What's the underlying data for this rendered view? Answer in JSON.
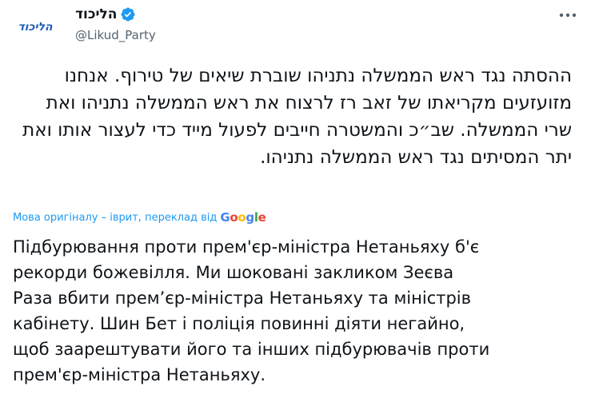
{
  "author": {
    "display_name": "הליכוד",
    "handle": "@Likud_Party",
    "verified": true,
    "avatar_logo_text": "הליכוד",
    "avatar_color": "#1c5db8",
    "verified_color": "#1d9bf0"
  },
  "tweet": {
    "original_text": "ההסתה נגד ראש הממשלה נתניהו שוברת שיאים של טירוף. אנחנו מזועזעים מקריאתו של זאב רז לרצוח את ראש הממשלה נתניהו ואת שרי הממשלה. שב״כ והמשטרה חייבים לפעול מייד כדי לעצור אותו ואת יתר המסיתים נגד ראש הממשלה נתניהו.",
    "translation_note_link": "Мова оригіналу – іврит, переклад від",
    "translation_provider": "Google",
    "translated_text": "Підбурювання проти прем'єр-міністра Нетаньяху б'є\nрекорди божевілля. Ми шоковані закликом Зеєва\nРаза вбити прем’єр-міністра Нетаньяху та міністрів\nкабінету. Шин Бет і поліція повинні діяти негайно,\nщоб заарештувати його та інших підбурювачів проти\nпрем'єр-міністра Нетаньяху."
  },
  "icons": {
    "more": "more-horizontal-icon",
    "verified": "verified-badge-icon"
  }
}
